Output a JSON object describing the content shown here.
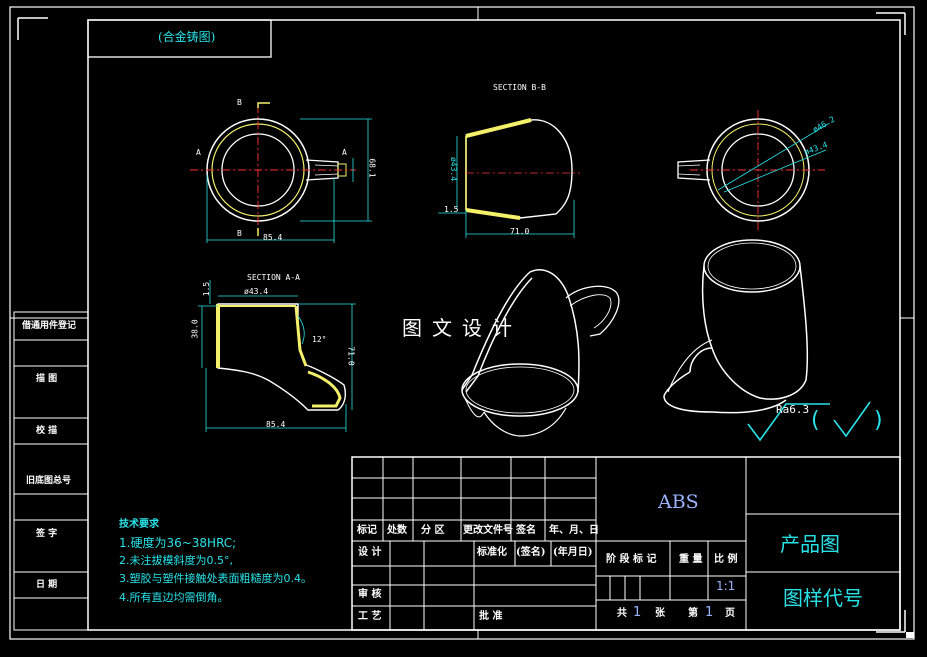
{
  "corner_box": {
    "text": "(合金铸图)"
  },
  "views": {
    "section_bb": "SECTION B-B",
    "section_aa": "SECTION A-A",
    "top_labels": {
      "b_top": "B",
      "b_bottom": "B",
      "a_left": "A",
      "a_right": "A"
    },
    "dims": {
      "d_85_4_top": "85.4",
      "d_68_1": "68.1",
      "d_43_4_bb": "ø43.4",
      "d_1_5_bb": "1.5",
      "d_71_0_bb": "71.0",
      "d_46_2": "ø46.2",
      "d_43_4_right": "ø43.4",
      "d_1_5_aa": "1.5",
      "d_43_4_aa": "ø43.4",
      "d_38_0": "38.0",
      "d_12": "12°",
      "d_71_0_aa": "71.0",
      "d_85_4_aa": "85.4"
    }
  },
  "watermark": "图文设计",
  "roughness": {
    "value": "Ra6.3",
    "paren_open": "(",
    "paren_close": ")"
  },
  "side_panel": [
    "借通用件登记",
    "描  图",
    "校  描",
    "旧底图总号",
    "签  字",
    "日  期"
  ],
  "tech_req": {
    "title": "技术要求",
    "items": [
      "1.硬度为36~38HRC;",
      "2.未注拔模斜度为0.5°,",
      "3.塑胶与塑件接触处表面粗糙度为0.4。",
      "4.所有直边均需倒角。"
    ]
  },
  "title_block": {
    "header_cells": [
      "标记",
      "处数",
      "分 区",
      "更改文件号",
      "签名",
      "年、月、日"
    ],
    "design": "设 计",
    "standardize": "标准化",
    "sign": "(签名)",
    "date": "(年月日)",
    "stage_label": "阶 段 标 记",
    "weight": "重 量",
    "scale_label": "比 例",
    "scale_value": "1:1",
    "review": "审 核",
    "process": "工 艺",
    "approve": "批 准",
    "material": "ABS",
    "product_name": "产品图",
    "drawing_code": "图样代号",
    "total_label": "共",
    "total_value": "1",
    "sheet_unit1": "张",
    "page_label": "第",
    "page_value": "1",
    "sheet_unit2": "页"
  }
}
